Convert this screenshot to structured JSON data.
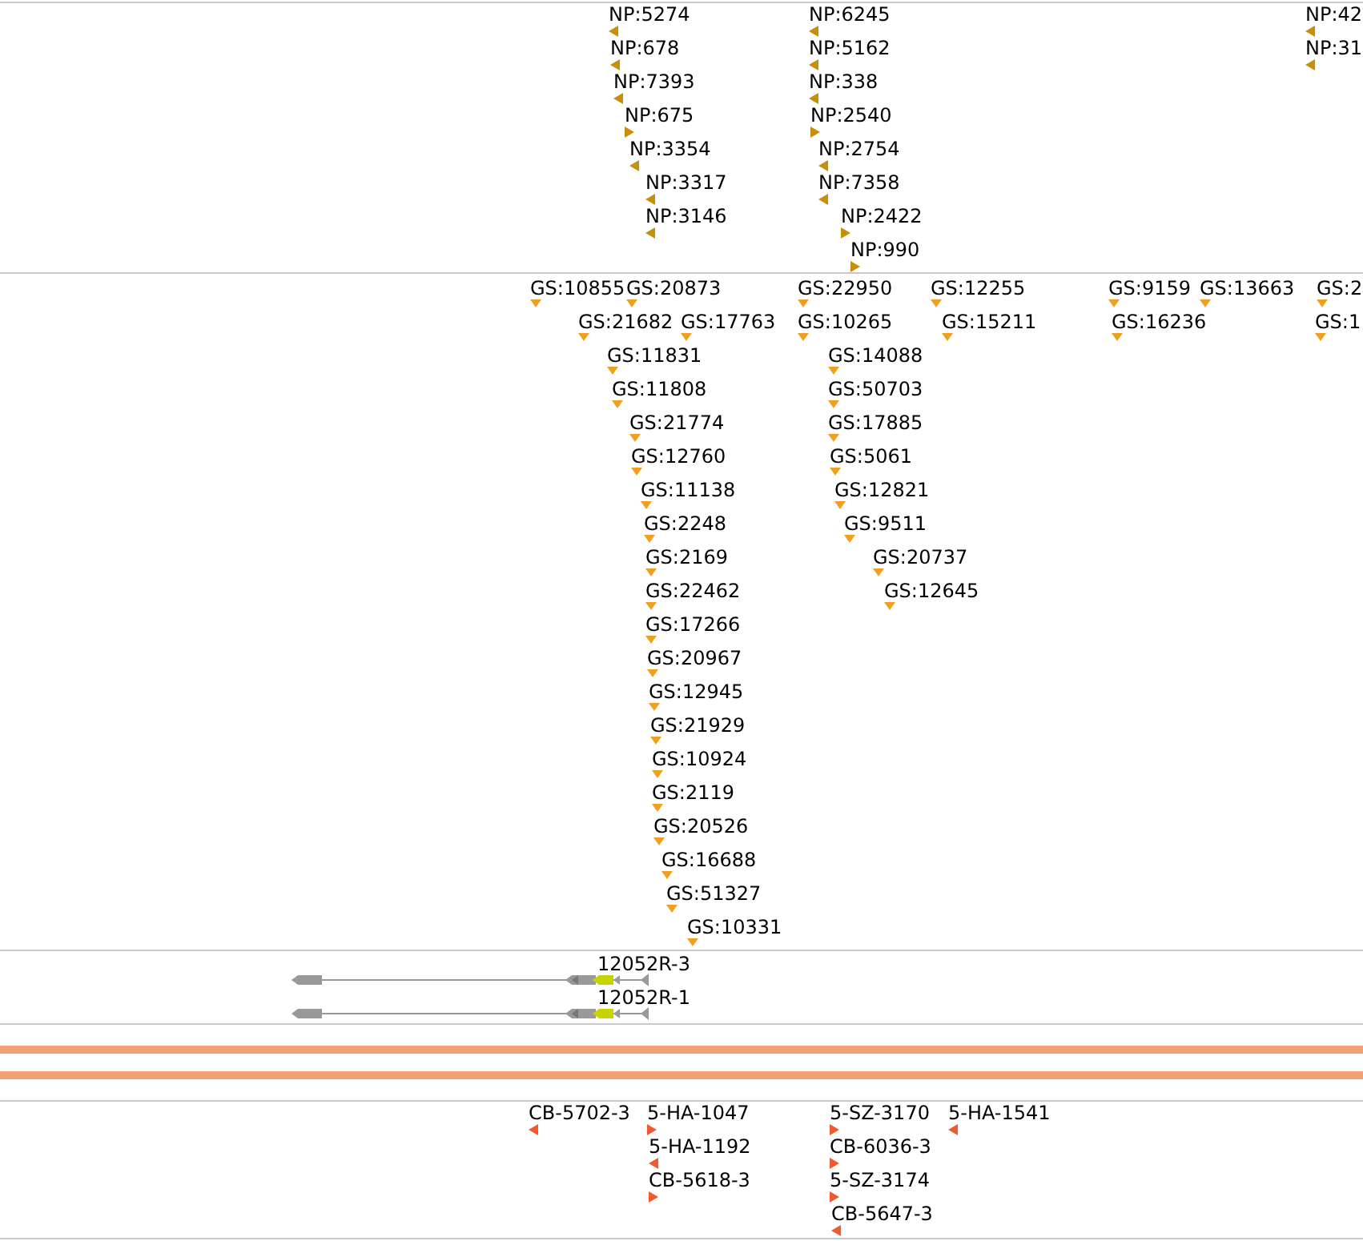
{
  "np_track": {
    "features": [
      {
        "label": "NP:5274",
        "reverse_strand": true
      },
      {
        "label": "NP:678",
        "reverse_strand": true
      },
      {
        "label": "NP:7393",
        "reverse_strand": true
      },
      {
        "label": "NP:675",
        "reverse_strand": false
      },
      {
        "label": "NP:3354",
        "reverse_strand": true
      },
      {
        "label": "NP:3317",
        "reverse_strand": true
      },
      {
        "label": "NP:3146",
        "reverse_strand": true
      },
      {
        "label": "NP:6245",
        "reverse_strand": true
      },
      {
        "label": "NP:5162",
        "reverse_strand": true
      },
      {
        "label": "NP:338",
        "reverse_strand": true
      },
      {
        "label": "NP:2540",
        "reverse_strand": false
      },
      {
        "label": "NP:2754",
        "reverse_strand": true
      },
      {
        "label": "NP:7358",
        "reverse_strand": true
      },
      {
        "label": "NP:2422",
        "reverse_strand": false
      },
      {
        "label": "NP:990",
        "reverse_strand": false
      },
      {
        "label": "NP:42",
        "reverse_strand": true
      },
      {
        "label": "NP:31",
        "reverse_strand": true
      }
    ]
  },
  "gs_track": {
    "features": [
      {
        "label": "GS:10855"
      },
      {
        "label": "GS:20873"
      },
      {
        "label": "GS:22950"
      },
      {
        "label": "GS:12255"
      },
      {
        "label": "GS:9159"
      },
      {
        "label": "GS:13663"
      },
      {
        "label": "GS:2"
      },
      {
        "label": "GS:21682"
      },
      {
        "label": "GS:17763"
      },
      {
        "label": "GS:10265"
      },
      {
        "label": "GS:15211"
      },
      {
        "label": "GS:16236"
      },
      {
        "label": "GS:1"
      },
      {
        "label": "GS:11831"
      },
      {
        "label": "GS:14088"
      },
      {
        "label": "GS:11808"
      },
      {
        "label": "GS:50703"
      },
      {
        "label": "GS:21774"
      },
      {
        "label": "GS:17885"
      },
      {
        "label": "GS:12760"
      },
      {
        "label": "GS:5061"
      },
      {
        "label": "GS:11138"
      },
      {
        "label": "GS:12821"
      },
      {
        "label": "GS:2248"
      },
      {
        "label": "GS:9511"
      },
      {
        "label": "GS:2169"
      },
      {
        "label": "GS:20737"
      },
      {
        "label": "GS:22462"
      },
      {
        "label": "GS:12645"
      },
      {
        "label": "GS:17266"
      },
      {
        "label": "GS:20967"
      },
      {
        "label": "GS:12945"
      },
      {
        "label": "GS:21929"
      },
      {
        "label": "GS:10924"
      },
      {
        "label": "GS:2119"
      },
      {
        "label": "GS:20526"
      },
      {
        "label": "GS:16688"
      },
      {
        "label": "GS:51327"
      },
      {
        "label": "GS:10331"
      }
    ]
  },
  "gene_track": {
    "transcripts": [
      {
        "name": "12052R-3"
      },
      {
        "name": "12052R-1"
      }
    ]
  },
  "cb_track": {
    "features": [
      {
        "label": "CB-5702-3",
        "reverse_strand": true
      },
      {
        "label": "5-HA-1047",
        "reverse_strand": false
      },
      {
        "label": "5-SZ-3170",
        "reverse_strand": false
      },
      {
        "label": "5-HA-1541",
        "reverse_strand": true
      },
      {
        "label": "5-HA-1192",
        "reverse_strand": true
      },
      {
        "label": "CB-6036-3",
        "reverse_strand": false
      },
      {
        "label": "CB-5618-3",
        "reverse_strand": false
      },
      {
        "label": "5-SZ-3174",
        "reverse_strand": false
      },
      {
        "label": "CB-5647-3",
        "reverse_strand": true
      }
    ]
  }
}
